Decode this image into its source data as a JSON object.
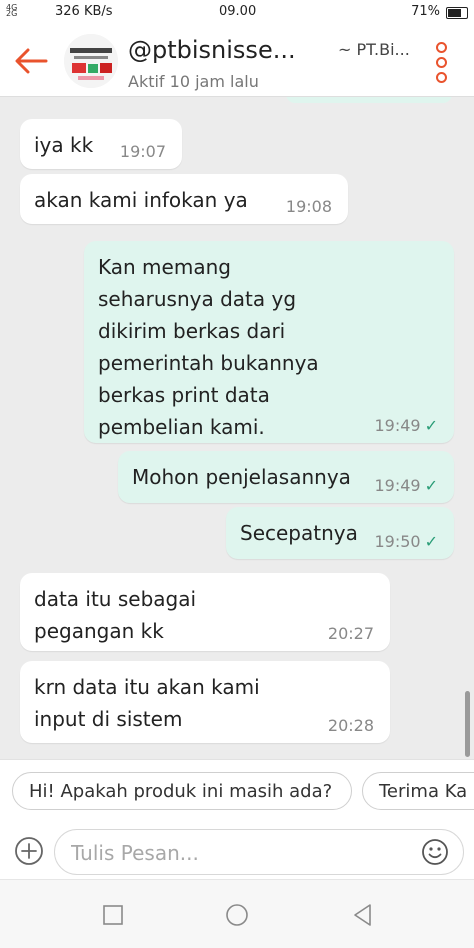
{
  "status_bar": {
    "signal_top": "4G",
    "signal_bottom": "2G",
    "speed": "326 KB/s",
    "time": "09.00",
    "battery": "71%"
  },
  "header": {
    "name": "@ptbisnisse...",
    "shop": "~ PT.Bi...",
    "status": "Aktif 10 jam lalu"
  },
  "messages": [
    {
      "dir": "in",
      "text": "iya kk",
      "time": "19:07"
    },
    {
      "dir": "in",
      "text": "akan kami infokan ya",
      "time": "19:08"
    },
    {
      "dir": "out",
      "text": "Kan memang\nseharusnya data yg\ndikirim berkas dari\npemerintah bukannya\nberkas print data\npembelian kami.",
      "time": "19:49",
      "read": true
    },
    {
      "dir": "out",
      "text": "Mohon penjelasannya",
      "time": "19:49",
      "read": true
    },
    {
      "dir": "out",
      "text": "Secepatnya",
      "time": "19:50",
      "read": true
    },
    {
      "dir": "in",
      "text": "data itu sebagai\npegangan kk",
      "time": "20:27"
    },
    {
      "dir": "in",
      "text": "krn data itu akan kami\ninput di sistem",
      "time": "20:28"
    }
  ],
  "quick_replies": [
    "Hi! Apakah produk ini masih ada?",
    "Terima Ka"
  ],
  "input": {
    "placeholder": "Tulis Pesan..."
  },
  "icons": [
    "back-arrow-icon",
    "more-vert-icon",
    "plus-icon",
    "smiley-icon",
    "check-icon",
    "nav-recents-icon",
    "nav-home-icon",
    "nav-back-icon"
  ],
  "colors": {
    "accent": "#e9532d",
    "outgoing_bubble": "#dff5ee",
    "incoming_bubble": "#ffffff",
    "chat_bg": "#ececec",
    "read_tick": "#2a9d77"
  }
}
